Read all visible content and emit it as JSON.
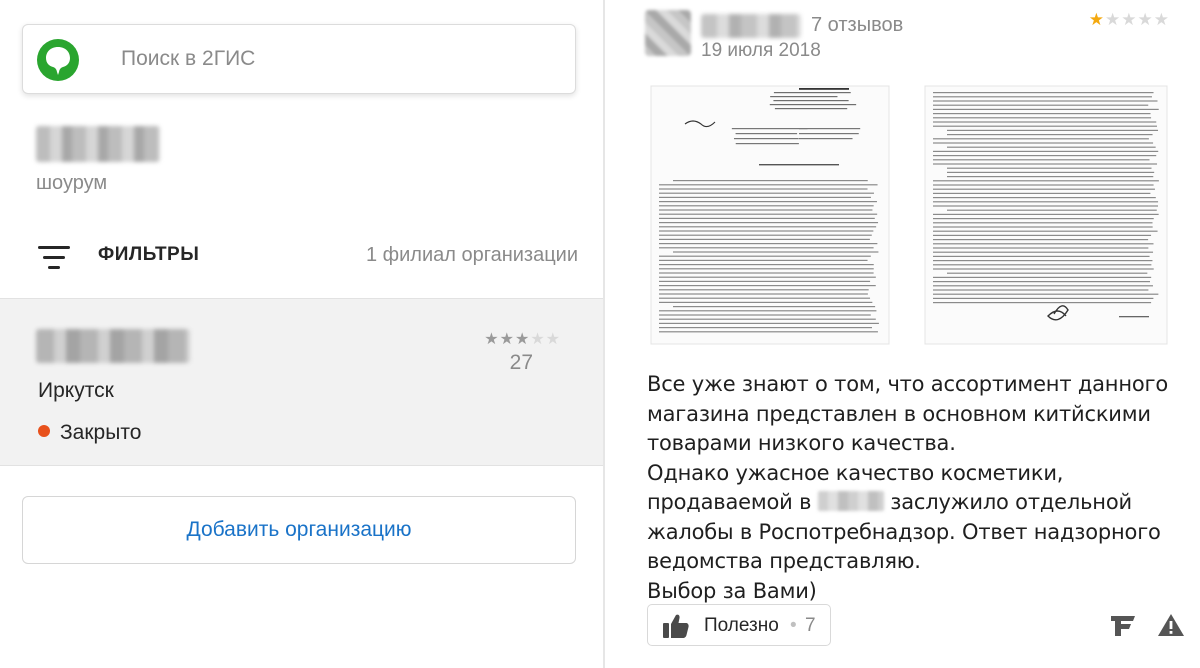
{
  "search": {
    "placeholder": "Поиск в 2ГИС"
  },
  "organization": {
    "type": "шоурум"
  },
  "filters": {
    "label": "ФИЛЬТРЫ",
    "branch_count": "1 филиал организации"
  },
  "branch": {
    "rating_stars": "★★★★★",
    "rating": 3,
    "reviews": "27",
    "city": "Иркутск",
    "status": "Закрыто"
  },
  "add_org_button": "Добавить организацию",
  "review": {
    "author_review_count": "7 отзывов",
    "date": "19 июля 2018",
    "rating_stars": "★★★★★",
    "rating": 1,
    "text_lines": [
      "Все уже знают о том, что ассортимент данного",
      "магазина представлен в основном китйскими",
      "товарами низкого качества.",
      "Однако ужасное качество косметики,",
      "продаваемой в",
      "заслужило отдельной",
      "жалобы в Роспотребнадзор. Ответ надзорного",
      "ведомства представляю.",
      "Выбор за Вами)"
    ],
    "helpful_label": "Полезно",
    "helpful_sep": "•",
    "helpful_count": "7"
  },
  "colors": {
    "accent_blue": "#1a73c8",
    "logo_green": "#2aa52f",
    "status_closed": "#e8511c",
    "star_active": "#f4a90f",
    "star_grey": "#9a9a9a",
    "star_empty": "#d9d9d9"
  },
  "icons": [
    "2gis-logo-icon",
    "filter-icon",
    "thumbs-up-icon",
    "flamp-icon",
    "warning-icon"
  ]
}
